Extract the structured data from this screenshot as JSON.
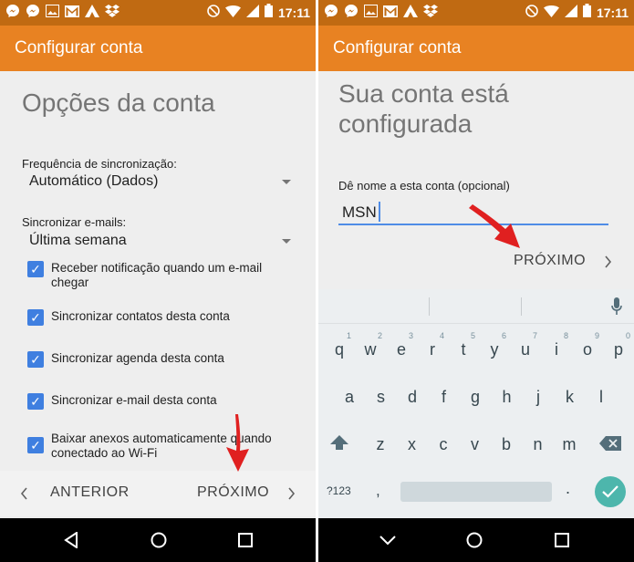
{
  "status_bar": {
    "time": "17:11",
    "icons_left": [
      "messenger-icon",
      "messenger-icon",
      "image-icon",
      "gmail-icon",
      "airdroid-icon",
      "dropbox-icon"
    ],
    "icons_right": [
      "block-icon",
      "wifi-icon",
      "signal-icon",
      "battery-icon"
    ]
  },
  "left": {
    "appbar_title": "Configurar conta",
    "heading": "Opções da conta",
    "sync_frequency": {
      "label": "Frequência de sincronização:",
      "value": "Automático (Dados)"
    },
    "sync_emails": {
      "label": "Sincronizar e-mails:",
      "value": "Última semana"
    },
    "checkboxes": [
      {
        "label": "Receber notificação quando um e-mail chegar",
        "checked": true
      },
      {
        "label": "Sincronizar contatos desta conta",
        "checked": true
      },
      {
        "label": "Sincronizar agenda desta conta",
        "checked": true
      },
      {
        "label": "Sincronizar e-mail desta conta",
        "checked": true
      },
      {
        "label": "Baixar anexos automaticamente quando conectado ao Wi-Fi",
        "checked": true
      }
    ],
    "back_label": "ANTERIOR",
    "next_label": "PRÓXIMO"
  },
  "right": {
    "appbar_title": "Configurar conta",
    "heading_line1": "Sua conta está",
    "heading_line2": "configurada",
    "name_label": "Dê nome a esta conta (opcional)",
    "name_value": "MSN",
    "next_label": "PRÓXIMO"
  },
  "keyboard": {
    "row1": [
      {
        "k": "q",
        "n": "1"
      },
      {
        "k": "w",
        "n": "2"
      },
      {
        "k": "e",
        "n": "3"
      },
      {
        "k": "r",
        "n": "4"
      },
      {
        "k": "t",
        "n": "5"
      },
      {
        "k": "y",
        "n": "6"
      },
      {
        "k": "u",
        "n": "7"
      },
      {
        "k": "i",
        "n": "8"
      },
      {
        "k": "o",
        "n": "9"
      },
      {
        "k": "p",
        "n": "0"
      }
    ],
    "row2": [
      "a",
      "s",
      "d",
      "f",
      "g",
      "h",
      "j",
      "k",
      "l"
    ],
    "row3": [
      "z",
      "x",
      "c",
      "v",
      "b",
      "n",
      "m"
    ],
    "symbols_key": "?123",
    "comma_key": ",",
    "period_key": "."
  },
  "colors": {
    "status_bar": "#c06a12",
    "app_bar": "#e88222",
    "checkbox": "#3f7fe0",
    "input_underline": "#4f8ce6",
    "enter_key": "#4db6ac",
    "annotation_arrow": "#e02020"
  }
}
